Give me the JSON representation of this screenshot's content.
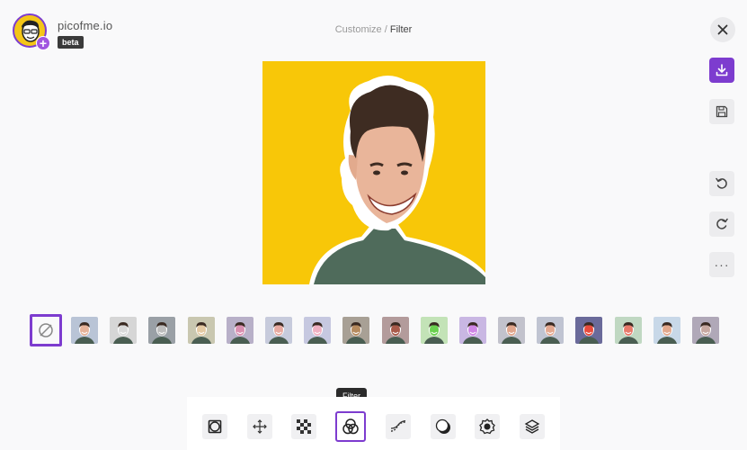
{
  "brand": {
    "name": "picofme.io",
    "badge": "beta",
    "logo_icon": "avatar-logo-icon",
    "add_icon": "plus-icon",
    "accent": "#7d3ccf"
  },
  "breadcrumb": {
    "parent": "Customize",
    "separator": " / ",
    "current": "Filter"
  },
  "window": {
    "close_icon": "close-icon"
  },
  "side_actions": [
    {
      "name": "download",
      "icon": "download-icon"
    },
    {
      "name": "save",
      "icon": "save-icon"
    },
    {
      "name": "undo",
      "icon": "undo-icon"
    },
    {
      "name": "redo",
      "icon": "redo-icon"
    },
    {
      "name": "more",
      "icon": "more-icon",
      "label": "···"
    }
  ],
  "preview": {
    "background": "#f8c708"
  },
  "filters": {
    "selected": "none",
    "none_icon": "no-filter-icon",
    "items": [
      {
        "bg": "#b9c4d6",
        "skin": "#e6b39a"
      },
      {
        "bg": "#d6d6d6",
        "skin": "#d9d9d9"
      },
      {
        "bg": "#9aa0a6",
        "skin": "#bdbdbd"
      },
      {
        "bg": "#c9c7b0",
        "skin": "#e4c9a3"
      },
      {
        "bg": "#b8b0c8",
        "skin": "#d98fb0"
      },
      {
        "bg": "#c7cbdc",
        "skin": "#e8a9a0"
      },
      {
        "bg": "#c6c8e0",
        "skin": "#f0b0c2"
      },
      {
        "bg": "#a8a095",
        "skin": "#b58a5e"
      },
      {
        "bg": "#b39b9b",
        "skin": "#a85a4a"
      },
      {
        "bg": "#c3e3b7",
        "skin": "#6ad04f"
      },
      {
        "bg": "#c9b7e3",
        "skin": "#cf86e6"
      },
      {
        "bg": "#c2c2cc",
        "skin": "#e0a58c"
      },
      {
        "bg": "#c0c4d2",
        "skin": "#e4a890"
      },
      {
        "bg": "#6a6a9a",
        "skin": "#e84a3c"
      },
      {
        "bg": "#c0d8c2",
        "skin": "#e87a6a"
      },
      {
        "bg": "#c8d8e8",
        "skin": "#e2a88c"
      },
      {
        "bg": "#b0a8b8",
        "skin": "#c7a8a0"
      }
    ]
  },
  "toolbar": {
    "active": "filter",
    "tooltip": "Filter",
    "tools": [
      {
        "name": "frame",
        "icon": "frame-icon"
      },
      {
        "name": "move",
        "icon": "move-icon"
      },
      {
        "name": "background",
        "icon": "checkerboard-icon"
      },
      {
        "name": "filter",
        "icon": "filter-icon"
      },
      {
        "name": "curves",
        "icon": "curve-icon"
      },
      {
        "name": "shadow",
        "icon": "shadow-icon"
      },
      {
        "name": "effects",
        "icon": "badge-icon"
      },
      {
        "name": "layers",
        "icon": "layers-icon"
      }
    ]
  }
}
